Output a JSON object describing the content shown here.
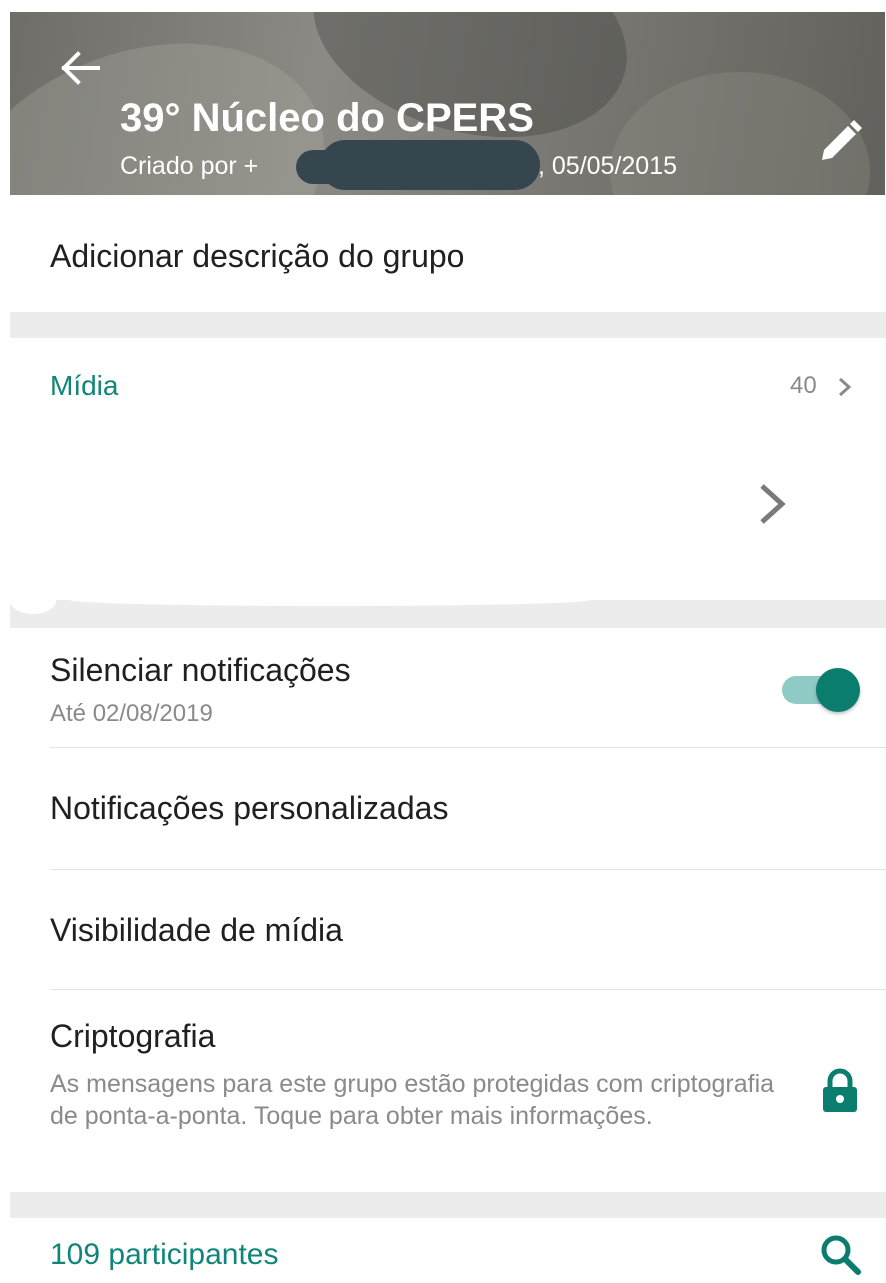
{
  "header": {
    "title": "39° Núcleo do CPERS",
    "created_by_prefix": "Criado por +",
    "created_date": ", 05/05/2015",
    "back_icon": "arrow-left-icon",
    "edit_icon": "pencil-icon"
  },
  "description": {
    "label": "Adicionar descrição do grupo"
  },
  "media": {
    "label": "Mídia",
    "count": "40",
    "chevron_icon": "chevron-right-icon"
  },
  "mute": {
    "title": "Silenciar notificações",
    "subtitle": "Até 02/08/2019",
    "enabled": true
  },
  "custom_notifications": {
    "label": "Notificações personalizadas"
  },
  "media_visibility": {
    "label": "Visibilidade de mídia"
  },
  "encryption": {
    "title": "Criptografia",
    "description": "As mensagens para este grupo estão protegidas com criptografia de ponta-a-ponta. Toque para obter mais informações.",
    "icon": "lock-icon"
  },
  "participants": {
    "label": "109 participantes",
    "search_icon": "search-icon"
  },
  "colors": {
    "accent": "#10857a",
    "toggle_on": "#0a7d6f",
    "toggle_track": "#8fcbc4",
    "secondary_text": "#8a8a8a"
  }
}
